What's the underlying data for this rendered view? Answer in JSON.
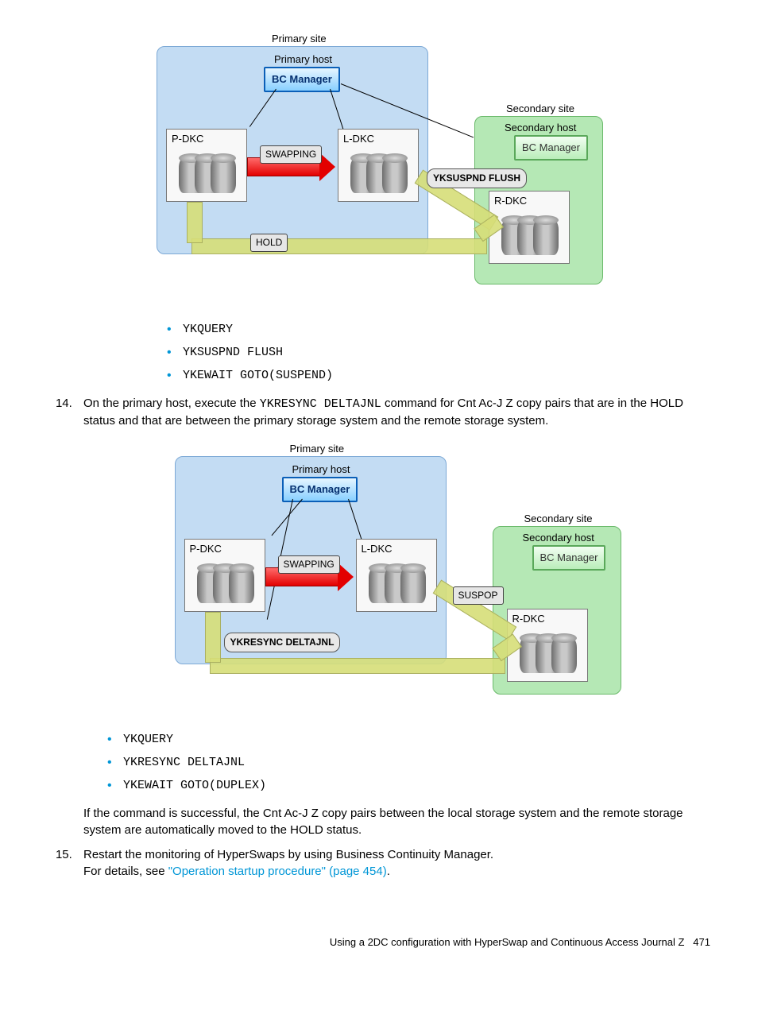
{
  "figure1": {
    "primary_site": "Primary site",
    "primary_host": "Primary host",
    "bc_primary": "BC Manager",
    "secondary_site": "Secondary site",
    "secondary_host": "Secondary host",
    "bc_secondary": "BC Manager",
    "p_dkc": "P-DKC",
    "l_dkc": "L-DKC",
    "r_dkc": "R-DKC",
    "swapping": "SWAPPING",
    "op_label": "YKSUSPND FLUSH",
    "bottom_status": "HOLD"
  },
  "cmds1": [
    "YKQUERY",
    "YKSUSPND FLUSH",
    "YKEWAIT GOTO(SUSPEND)"
  ],
  "step14_pre": "On the primary host, execute the ",
  "step14_cmd": "YKRESYNC DELTAJNL",
  "step14_post": " command for Cnt Ac-J Z copy pairs that are in the HOLD status and that are between the primary storage system and the remote storage system.",
  "figure2": {
    "primary_site": "Primary site",
    "primary_host": "Primary host",
    "bc_primary": "BC Manager",
    "secondary_site": "Secondary site",
    "secondary_host": "Secondary host",
    "bc_secondary": "BC Manager",
    "p_dkc": "P-DKC",
    "l_dkc": "L-DKC",
    "r_dkc": "R-DKC",
    "swapping": "SWAPPING",
    "op_label": "YKRESYNC DELTAJNL",
    "side_status": "SUSPOP"
  },
  "cmds2": [
    "YKQUERY",
    "YKRESYNC DELTAJNL",
    "YKEWAIT GOTO(DUPLEX)"
  ],
  "step14_result": "If the command is successful, the Cnt Ac-J Z copy pairs between the local storage system and the remote storage system are automatically moved to the HOLD status.",
  "step15_text": "Restart the monitoring of HyperSwaps by using Business Continuity Manager.",
  "step15_details_pre": "For details, see ",
  "step15_link": "\"Operation startup procedure\" (page 454)",
  "step15_details_post": ".",
  "footer_text": "Using a 2DC configuration with HyperSwap and Continuous Access Journal Z",
  "footer_page": "471"
}
